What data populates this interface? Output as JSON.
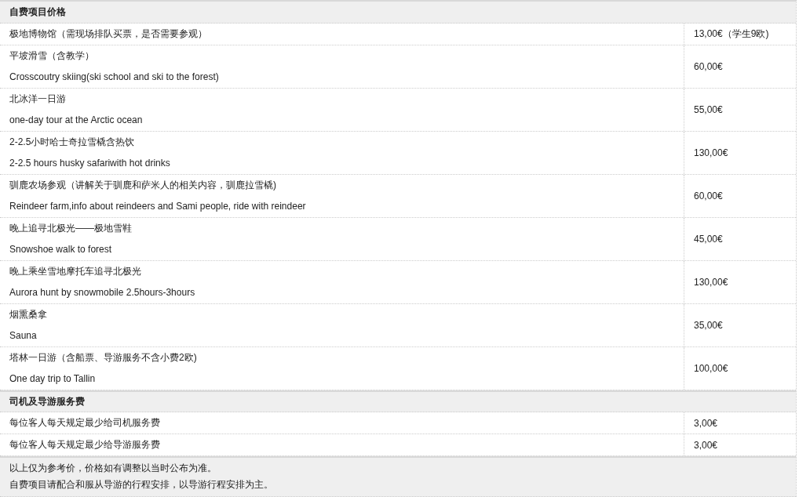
{
  "sections": [
    {
      "title": "自费项目价格",
      "rows": [
        {
          "lines": [
            "极地博物馆（需现场排队买票，是否需要参观）"
          ],
          "price": "13,00€（学生9欧)"
        },
        {
          "lines": [
            "平坡滑雪（含教学）",
            "Crosscoutry skiing(ski school and ski to the forest)"
          ],
          "price": "60,00€"
        },
        {
          "lines": [
            "北冰洋一日游",
            "one-day tour at the Arctic ocean"
          ],
          "price": "55,00€"
        },
        {
          "lines": [
            "2-2.5小时哈士奇拉雪橇含热饮",
            "2-2.5 hours husky safariwith hot drinks"
          ],
          "price": "130,00€"
        },
        {
          "lines": [
            "驯鹿农场参观（讲解关于驯鹿和萨米人的相关内容，驯鹿拉雪橇)",
            "Reindeer farm,info about reindeers and Sami people, ride with reindeer"
          ],
          "price": "60,00€"
        },
        {
          "lines": [
            "晚上追寻北极光——极地雪鞋",
            "Snowshoe walk to forest"
          ],
          "price": "45,00€"
        },
        {
          "lines": [
            "晚上乘坐雪地摩托车追寻北极光",
            "Aurora hunt by snowmobile 2.5hours-3hours"
          ],
          "price": "130,00€"
        },
        {
          "lines": [
            "烟熏桑拿",
            "Sauna"
          ],
          "price": "35,00€"
        },
        {
          "lines": [
            "塔林一日游（含船票、导游服务不含小费2欧)",
            "One day trip to Tallin"
          ],
          "price": "100,00€"
        }
      ]
    },
    {
      "title": "司机及导游服务费",
      "rows": [
        {
          "lines": [
            "每位客人每天规定最少给司机服务费"
          ],
          "price": "3,00€"
        },
        {
          "lines": [
            "每位客人每天规定最少给导游服务费"
          ],
          "price": "3,00€"
        }
      ]
    }
  ],
  "notes": [
    "以上仅为参考价，价格如有调整以当时公布为准。",
    "自费项目请配合和服从导游的行程安排，以导游行程安排为主。"
  ]
}
